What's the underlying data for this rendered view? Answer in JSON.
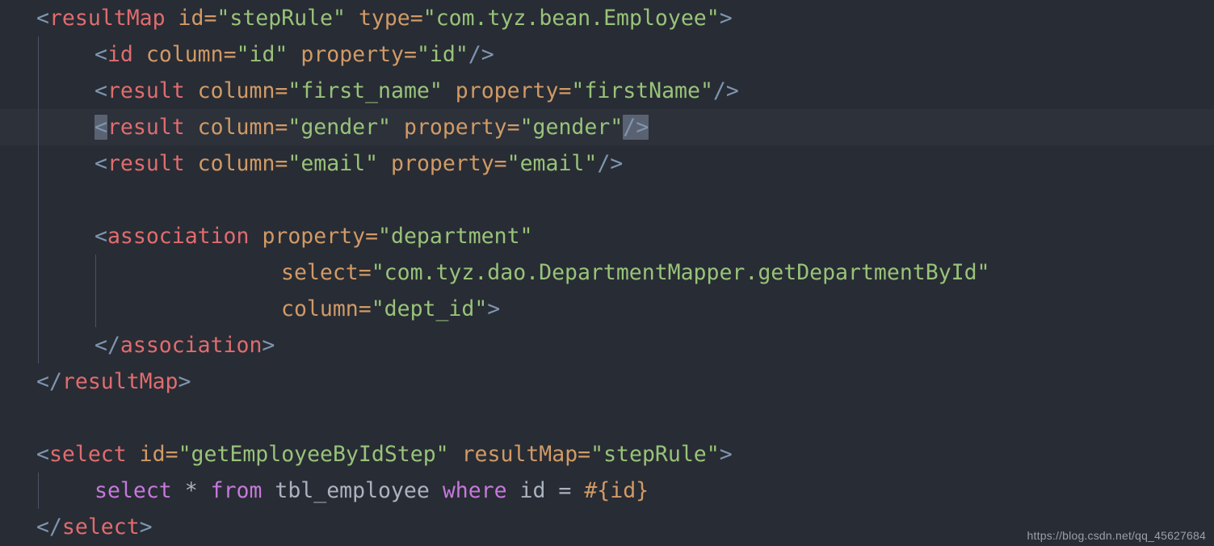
{
  "editor": {
    "language": "xml",
    "theme_name": "one-dark",
    "background_color": "#282c34",
    "active_line_color": "#2c313a",
    "indent_guide_color": "#4b5263",
    "bracket_match_color": "#5a6272",
    "default_text_color": "#abb2bf",
    "token_colors": {
      "punctuation": "#7f95b0",
      "tag": "#e06c6f",
      "attribute": "#d19a66",
      "string": "#98c379",
      "keyword": "#c678dd",
      "text": "#abb2bf"
    },
    "active_line_number": 4,
    "total_lines": 14
  },
  "code": {
    "line1": {
      "open": "<",
      "tag": "resultMap",
      "space1": " ",
      "attr1": "id",
      "eq1": "=",
      "val1": "\"stepRule\"",
      "space2": " ",
      "attr2": "type",
      "eq2": "=",
      "val2": "\"com.tyz.bean.Employee\"",
      "close": ">"
    },
    "line2": {
      "open": "<",
      "tag": "id",
      "space1": " ",
      "attr1": "column",
      "eq1": "=",
      "val1": "\"id\"",
      "space2": " ",
      "attr2": "property",
      "eq2": "=",
      "val2": "\"id\"",
      "close": "/>"
    },
    "line3": {
      "open": "<",
      "tag": "result",
      "space1": " ",
      "attr1": "column",
      "eq1": "=",
      "val1": "\"first_name\"",
      "space2": " ",
      "attr2": "property",
      "eq2": "=",
      "val2": "\"firstName\"",
      "close": "/>"
    },
    "line4": {
      "open": "<",
      "tag": "result",
      "space1": " ",
      "attr1": "column",
      "eq1": "=",
      "val1": "\"gender\"",
      "space2": " ",
      "attr2": "property",
      "eq2": "=",
      "val2": "\"gender\"",
      "close": "/>"
    },
    "line5": {
      "open": "<",
      "tag": "result",
      "space1": " ",
      "attr1": "column",
      "eq1": "=",
      "val1": "\"email\"",
      "space2": " ",
      "attr2": "property",
      "eq2": "=",
      "val2": "\"email\"",
      "close": "/>"
    },
    "line6": "",
    "line7": {
      "open": "<",
      "tag": "association",
      "space1": " ",
      "attr1": "property",
      "eq1": "=",
      "val1": "\"department\""
    },
    "line8": {
      "attr": "select",
      "eq": "=",
      "val": "\"com.tyz.dao.DepartmentMapper.getDepartmentById\""
    },
    "line9": {
      "attr": "column",
      "eq": "=",
      "val": "\"dept_id\"",
      "close": ">"
    },
    "line10": {
      "open": "</",
      "tag": "association",
      "close": ">"
    },
    "line11": {
      "open": "</",
      "tag": "resultMap",
      "close": ">"
    },
    "line12": "",
    "line13": {
      "open": "<",
      "tag": "select",
      "space1": " ",
      "attr1": "id",
      "eq1": "=",
      "val1": "\"getEmployeeByIdStep\"",
      "space2": " ",
      "attr2": "resultMap",
      "eq2": "=",
      "val2": "\"stepRule\"",
      "close": ">"
    },
    "line14": {
      "kw1": "select",
      "star": " * ",
      "kw2": "from",
      "table": " tbl_employee ",
      "kw3": "where",
      "cond": " id = ",
      "param": "#{id}"
    },
    "line15": {
      "open": "</",
      "tag": "select",
      "close": ">"
    }
  },
  "watermark": {
    "text": "https://blog.csdn.net/qq_45627684"
  }
}
